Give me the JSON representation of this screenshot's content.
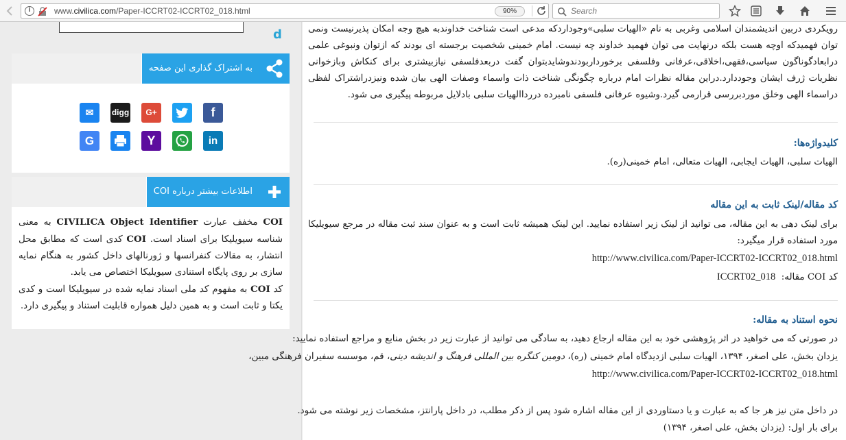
{
  "browser": {
    "url_prefix": "www.",
    "url_host": "civilica.com",
    "url_path": "/Paper-ICCRT02-ICCRT02_018.html",
    "zoom": "90%",
    "search_placeholder": "Search"
  },
  "sidebar": {
    "share_title": "به اشتراک گذاری این صفحه",
    "coi_title": "اطلاعات بیشتر درباره COI",
    "coi_p1_a": "COI",
    "coi_p1_b": " مخفف عبارت ",
    "coi_p1_c": "CIVILICA Object Identifier",
    "coi_p1_d": " به معنی شناسه سیویلیکا برای اسناد است. ",
    "coi_p1_e": "COI",
    "coi_p1_f": " کدی است که مطابق محل انتشار، به مقالات کنفرانسها و ژورنالهای داخل کشور به هنگام نمایه سازی بر روی پایگاه استنادی سیویلیکا اختصاص می یابد.",
    "coi_p2_a": "کد ",
    "coi_p2_b": "COI",
    "coi_p2_c": " به مفهوم کد ملی اسناد نمایه شده در سیویلیکا است و کدی یکتا و ثابت است و به همین دلیل همواره قابلیت استناد و پیگیری دارد."
  },
  "social": {
    "email": "✉",
    "digg": "digg",
    "gplus": "G+",
    "twitter": "t",
    "facebook": "f",
    "google": "G",
    "print": "⎙",
    "yahoo": "Y",
    "whatsapp": "✆",
    "linkedin": "in",
    "colors": {
      "email": "#1a84f0",
      "digg": "#1b1b1b",
      "gplus": "#dd4b39",
      "twitter": "#1da1f2",
      "facebook": "#3b5998",
      "google": "#4285f4",
      "print": "#1a84f0",
      "yahoo": "#5d0d9e",
      "whatsapp": "#25a244",
      "linkedin": "#0a7bb6"
    }
  },
  "article": {
    "abstract": "رویکردی دربین اندیشمندان اسلامی وغربی به نام «الهیات سلبی»وجوداردکه مدعی است شناخت خداوندبه هیچ وجه امکان پذیرنیست ونمی توان فهمیدکه اوچه هست بلکه درنهایت می توان فهمید خداوند چه نیست. امام خمینی شخصیت برجسته ای بودند که ازتوان ونبوغی علمی درابعادگوناگون سیاسی،فقهی،اخلاقی،عرفانی وفلسفی برخورداربودندوشایدبتوان گفت دربعدفلسفی نیازبیشتری برای کنکاش وبازخوانی نظریات ژرف ایشان وجوددارد.دراین مقاله نظرات امام درباره چگونگی شناخت ذات واسماء وصفات الهی بیان شده ونیزدراشتراک لفظی دراسماء الهی وخلق موردبررسی قرارمی گیرد.وشیوه عرفانی فلسفی نامبرده دررداالهیات سلبی بادلایل مربوطه پیگیری می شود.",
    "keywords_title": "کلیدواژه‌ها:",
    "keywords": "الهیات سلبی، الهیات ایجابی، الهیات متعالی، امام خمینی(ره).",
    "link_title": "کد مقاله/لینک ثابت به این مقاله",
    "link_desc": "برای لینک دهی به این مقاله، می توانید از لینک زیر استفاده نمایید. این لینک همیشه ثابت است و به عنوان سند ثبت مقاله در مرجع سیویلیکا مورد استفاده قرار میگیرد:",
    "link_url": "http://www.civilica.com/Paper-ICCRT02-ICCRT02_018.html",
    "coi_label": "کد COI مقاله:",
    "coi_value": "ICCRT02_018",
    "cite_title": "نحوه استناد به مقاله:",
    "cite_desc": "در صورتی که می خواهید در اثر پژوهشی خود به این مقاله ارجاع دهید، به سادگی می توانید از عبارت زیر در بخش منابع و مراجع استفاده نمایید:",
    "cite_ref_a": "یزدان بخش، علی اصغر، ۱۳۹۴، الهیات سلبی ازدیدگاه امام خمینی (ره)، ",
    "cite_ref_b": "دومین کنگره بین المللی فرهنگ و اندیشه دینی",
    "cite_ref_c": "، قم، موسسه سفیران فرهنگی مبین،",
    "cite_url": "http://www.civilica.com/Paper-ICCRT02-ICCRT02_018.html",
    "intext_desc": "در داخل متن نیز هر جا که به عبارت و یا دستاوردی از این مقاله اشاره شود پس از ذکر مطلب، در داخل پارانتز، مشخصات زیر نوشته می شود.",
    "first_time": "برای بار اول: (یزدان بخش، علی اصغر، ۱۳۹۴)"
  }
}
